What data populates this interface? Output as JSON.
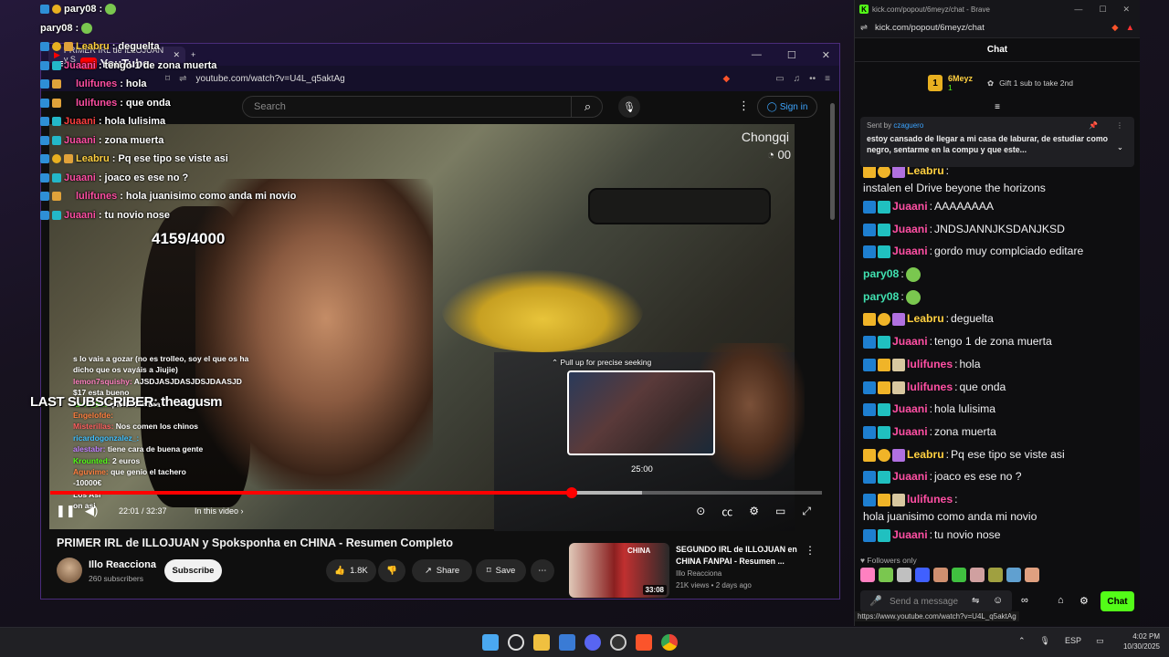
{
  "overlay_chat": [
    {
      "badges": [
        "blue",
        "gold"
      ],
      "name": "pary08",
      "name_color": "teal",
      "text": "",
      "emote": true
    },
    {
      "badges": [],
      "name": "pary08",
      "name_color": "teal",
      "text": "",
      "emote": true
    },
    {
      "badges": [
        "blue",
        "gold",
        "orange"
      ],
      "name": "Leabru",
      "name_color": "gold",
      "text": "deguelta"
    },
    {
      "badges": [
        "blue",
        "teal"
      ],
      "name": "Juaani",
      "name_color": "pink",
      "text": "tengo 1 de zona muerta"
    },
    {
      "badges": [
        "blue",
        "orange",
        "cream"
      ],
      "name": "lulifunes",
      "name_color": "pink",
      "text": "hola"
    },
    {
      "badges": [
        "blue",
        "orange",
        "cream"
      ],
      "name": "lulifunes",
      "name_color": "pink",
      "text": "que onda"
    },
    {
      "badges": [
        "blue",
        "teal"
      ],
      "name": "Juaani",
      "name_color": "red",
      "text": "hola lulisima"
    },
    {
      "badges": [
        "blue",
        "teal"
      ],
      "name": "Juaani",
      "name_color": "pink",
      "text": "zona muerta"
    },
    {
      "badges": [
        "blue",
        "gold",
        "orange"
      ],
      "name": "Leabru",
      "name_color": "gold",
      "text": "Pq ese tipo se viste asi"
    },
    {
      "badges": [
        "blue",
        "teal"
      ],
      "name": "Juaani",
      "name_color": "pink",
      "text": "joaco es ese no ?"
    },
    {
      "badges": [
        "blue",
        "orange",
        "cream"
      ],
      "name": "lulifunes",
      "name_color": "pink",
      "text": "hola juanisimo como anda mi novio"
    },
    {
      "badges": [
        "blue",
        "teal"
      ],
      "name": "Juaani",
      "name_color": "pink",
      "text": "tu novio nose"
    }
  ],
  "browser": {
    "tab_title": "PRIMER IRL de ILLOJUAN y S",
    "url": "youtube.com/watch?v=U4L_q5aktAg",
    "search_placeholder": "Search",
    "sign_in": "Sign in",
    "logo_text": "YouTube"
  },
  "video": {
    "location_text": "Chongqi",
    "clock_text": "00",
    "counter": "4159/4000",
    "last_subscriber": "LAST SUBSCRIBER: theagusm",
    "seek_hint": "Pull up for precise seeking",
    "seek_time": "25:00",
    "time": "22:01 / 32:37",
    "in_this_video": "In this video",
    "progress_played": 0.676,
    "progress_buffered": 0.767,
    "stream_chat": [
      {
        "name": "",
        "text": "s lo vais a gozar (no es trolleo, soy el que os ha",
        "color": "#ffffff"
      },
      {
        "name": "",
        "text": "dicho que os vayáis a Jiujie)",
        "color": "#ffffff"
      },
      {
        "name": "lemon7squishy:",
        "text": "AJSDJASJDASJDSJDAASJD",
        "color": "#ff80c0"
      },
      {
        "name": "",
        "text": "$17 esta bueno",
        "color": "#ffd040"
      },
      {
        "name": "lavra_bs:",
        "text": "que te factura",
        "color": "#53fc18"
      },
      {
        "name": "Engelofde:",
        "text": "",
        "color": "#ff8040"
      },
      {
        "name": "Misterillas:",
        "text": "Nos comen los chinos",
        "color": "#ff6060"
      },
      {
        "name": "ricardogonzalez_:",
        "text": "",
        "color": "#40c0ff"
      },
      {
        "name": "alestabr:",
        "text": "tiene cara de buena gente",
        "color": "#c080ff"
      },
      {
        "name": "Krounted:",
        "text": "2 euros",
        "color": "#53fc18"
      },
      {
        "name": "Aguvime:",
        "text": "que genio el tachero",
        "color": "#ff8040"
      },
      {
        "name": "",
        "text": "-10000€",
        "color": "#ffffff"
      },
      {
        "name": "",
        "text": "Los Asi",
        "color": "#ffffff"
      },
      {
        "name": "",
        "text": "on asi",
        "color": "#ffffff"
      }
    ]
  },
  "watch": {
    "title": "PRIMER IRL de ILLOJUAN y Spoksponha en CHINA - Resumen Completo",
    "channel": "Illo Reacciona",
    "subscribers": "260 subscribers",
    "subscribe": "Subscribe",
    "likes": "1.8K",
    "share": "Share",
    "save": "Save"
  },
  "recommended": {
    "title": "SEGUNDO IRL de ILLOJUAN en CHINA FANPAI - Resumen ...",
    "channel": "Illo Reacciona",
    "meta": "21K views • 2 days ago",
    "duration": "33:08",
    "thumb_text": "CHINA"
  },
  "kick": {
    "window_title": "kick.com/popout/6meyz/chat - Brave",
    "url": "kick.com/popout/6meyz/chat",
    "header": "Chat",
    "gifter_name": "6Meyz",
    "gifter_count": "1",
    "gift_text": "Gift 1 sub to take 2nd",
    "pinned_sent_by": "Sent by",
    "pinned_user": "czaguero",
    "pinned_text": "estoy cansado de llegar a mi casa de laburar, de estudiar como negro, sentarme en la compu y que este...",
    "messages": [
      {
        "badges": [
          "crown",
          "one",
          "purple"
        ],
        "name": "Leabru",
        "color": "gold",
        "text": "instalen el Drive beyone the horizons",
        "emote": false
      },
      {
        "badges": [
          "blue",
          "teal"
        ],
        "name": "Juaani",
        "color": "pink",
        "text": "AAAAAAAA",
        "emote": false
      },
      {
        "badges": [
          "blue",
          "teal"
        ],
        "name": "Juaani",
        "color": "pink",
        "text": "JNDSJANNJKSDANJKSD",
        "emote": false
      },
      {
        "badges": [
          "blue",
          "teal"
        ],
        "name": "Juaani",
        "color": "pink",
        "text": "gordo muy complciado editare",
        "emote": false
      },
      {
        "badges": [],
        "name": "pary08",
        "color": "teal",
        "text": "",
        "emote": true
      },
      {
        "badges": [],
        "name": "pary08",
        "color": "teal",
        "text": "",
        "emote": true
      },
      {
        "badges": [
          "crown",
          "one",
          "purple"
        ],
        "name": "Leabru",
        "color": "gold",
        "text": "deguelta",
        "emote": false
      },
      {
        "badges": [
          "blue",
          "teal"
        ],
        "name": "Juaani",
        "color": "pink",
        "text": "tengo 1 de zona muerta",
        "emote": false
      },
      {
        "badges": [
          "blue",
          "crown",
          "cream"
        ],
        "name": "lulifunes",
        "color": "pink",
        "text": "hola",
        "emote": false
      },
      {
        "badges": [
          "blue",
          "crown",
          "cream"
        ],
        "name": "lulifunes",
        "color": "pink",
        "text": "que onda",
        "emote": false
      },
      {
        "badges": [
          "blue",
          "teal"
        ],
        "name": "Juaani",
        "color": "pink",
        "text": "hola lulisima",
        "emote": false
      },
      {
        "badges": [
          "blue",
          "teal"
        ],
        "name": "Juaani",
        "color": "pink",
        "text": "zona muerta",
        "emote": false
      },
      {
        "badges": [
          "crown",
          "one",
          "purple"
        ],
        "name": "Leabru",
        "color": "gold",
        "text": "Pq ese tipo se viste asi",
        "emote": false
      },
      {
        "badges": [
          "blue",
          "teal"
        ],
        "name": "Juaani",
        "color": "pink",
        "text": "joaco es ese no ?",
        "emote": false
      },
      {
        "badges": [
          "blue",
          "crown",
          "cream"
        ],
        "name": "lulifunes",
        "color": "pink",
        "text": "hola juanisimo como anda mi novio",
        "emote": false
      },
      {
        "badges": [
          "blue",
          "teal"
        ],
        "name": "Juaani",
        "color": "pink",
        "text": "tu novio nose",
        "emote": false
      }
    ],
    "followers_only": "Followers only",
    "send_placeholder": "Send a message",
    "chat_button": "Chat",
    "status_url": "https://www.youtube.com/watch?v=U4L_q5aktAg"
  },
  "taskbar": {
    "lang": "ESP",
    "time": "4:02 PM",
    "date": "10/30/2025"
  }
}
